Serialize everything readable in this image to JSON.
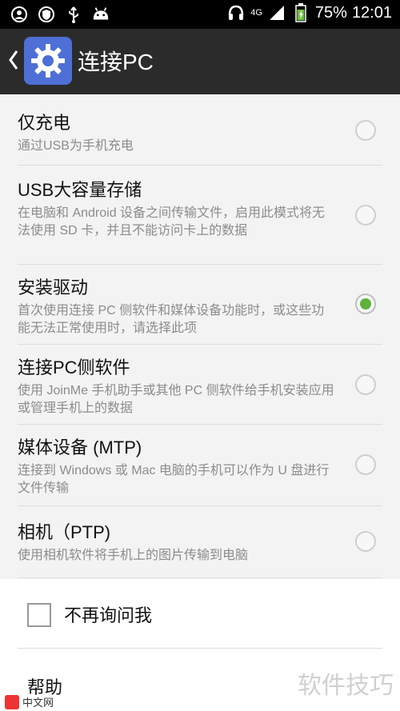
{
  "status_bar": {
    "battery_percent": "75%",
    "time": "12:01",
    "network": "4G",
    "icons": [
      "face-icon",
      "shield-icon",
      "usb-icon",
      "android-icon",
      "headset-icon",
      "signal-icon",
      "battery-icon"
    ]
  },
  "action_bar": {
    "title": "连接PC",
    "back_icon": "chevron-left-icon",
    "app_icon": "gear-icon",
    "app_icon_color": "#4d6fd6"
  },
  "options": [
    {
      "title": "仅充电",
      "description": "通过USB为手机充电",
      "selected": false
    },
    {
      "title": "USB大容量存储",
      "description": "在电脑和 Android 设备之间传输文件，启用此模式将无法使用 SD 卡，并且不能访问卡上的数据",
      "selected": false
    },
    {
      "title": "安装驱动",
      "description": "首次使用连接 PC 侧软件和媒体设备功能时，或这些功能无法正常使用时，请选择此项",
      "selected": true
    },
    {
      "title": "连接PC侧软件",
      "description": "使用 JoinMe 手机助手或其他 PC 侧软件给手机安装应用或管理手机上的数据",
      "selected": false
    },
    {
      "title": "媒体设备 (MTP)",
      "description": "连接到 Windows 或 Mac 电脑的手机可以作为 U 盘进行文件传输",
      "selected": false
    },
    {
      "title": "相机（PTP)",
      "description": "使用相机软件将手机上的图片传输到电脑",
      "selected": false
    }
  ],
  "dont_ask": {
    "label": "不再询问我",
    "checked": false
  },
  "help_label": "帮助",
  "watermark": "软件技巧",
  "logo_text": "中文网",
  "colors": {
    "accent_green": "#5db33a",
    "action_bar": "#2b2b2b",
    "background": "#f3f3f3"
  }
}
